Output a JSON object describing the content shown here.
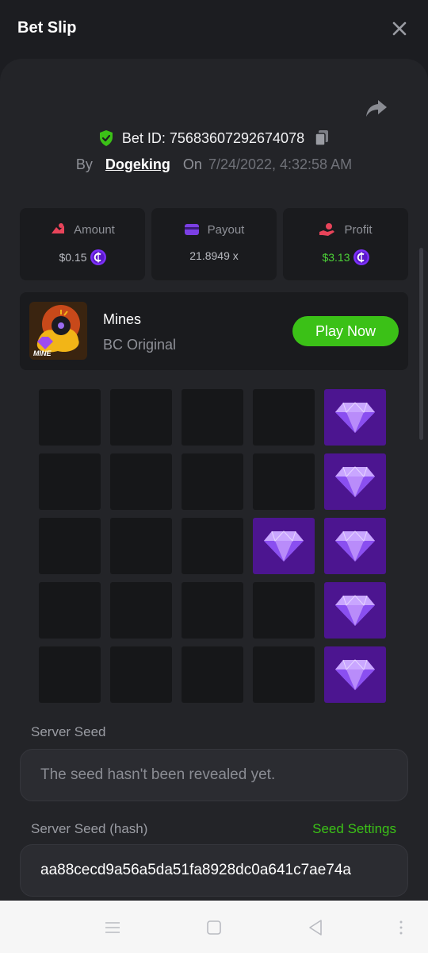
{
  "header": {
    "title": "Bet Slip"
  },
  "bet": {
    "id_label": "Bet ID: 75683607292674078",
    "by_label": "By",
    "user": "Dogeking",
    "on_label": "On",
    "date": "7/24/2022, 4:32:58 AM"
  },
  "stats": [
    {
      "label": "Amount",
      "value": "$0.15",
      "icon": "amount-icon",
      "color": "#e8445a"
    },
    {
      "label": "Payout",
      "value": "21.8949 x",
      "icon": "wallet-icon",
      "color": "#7b3fe4"
    },
    {
      "label": "Profit",
      "value": "$3.13",
      "icon": "hand-coin-icon",
      "color": "#e8445a"
    }
  ],
  "game": {
    "name": "Mines",
    "subtitle": "BC Original",
    "thumb_text": "MINE",
    "play_label": "Play Now"
  },
  "board": {
    "rows": 5,
    "cols": 5,
    "revealed_gems": [
      [
        0,
        4
      ],
      [
        1,
        4
      ],
      [
        2,
        3
      ],
      [
        2,
        4
      ],
      [
        3,
        4
      ],
      [
        4,
        4
      ]
    ]
  },
  "seeds": {
    "server_seed_label": "Server Seed",
    "server_seed_placeholder": "The seed hasn't been revealed yet.",
    "hash_label": "Server Seed (hash)",
    "settings_link": "Seed Settings",
    "hash_value": "aa88cecd9a56a5da51fa8928dc0a641c7ae74a"
  },
  "colors": {
    "accent_green": "#3bc117",
    "gem_tile": "#4c1590",
    "coin_purple": "#7b2ff7"
  }
}
